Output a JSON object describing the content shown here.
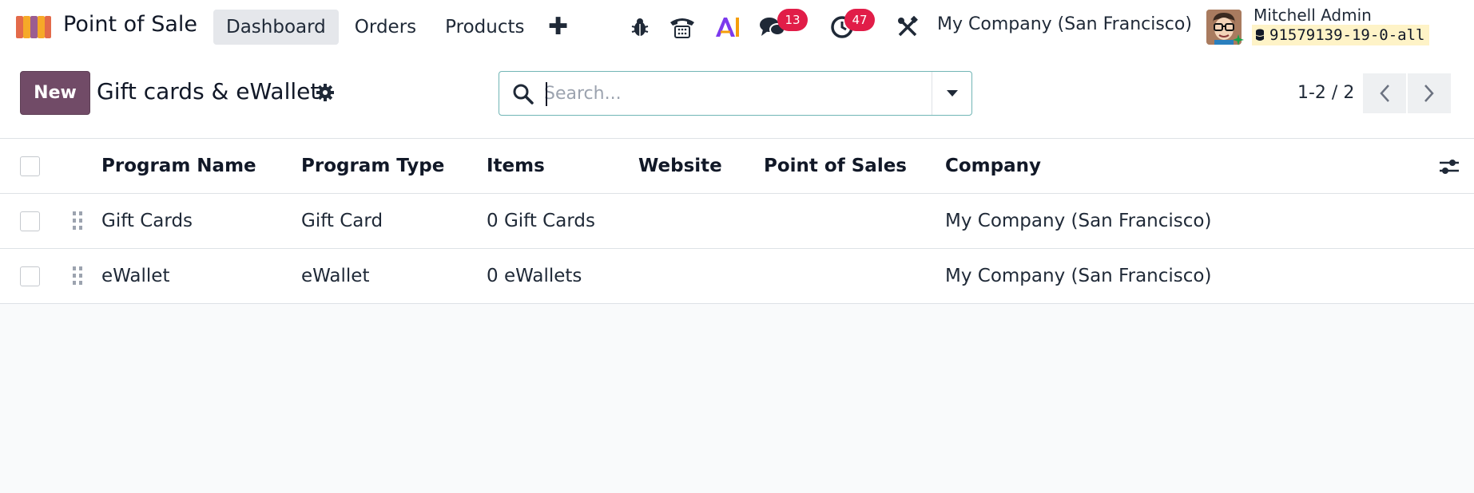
{
  "navbar": {
    "app_name": "Point of Sale",
    "menu": [
      "Dashboard",
      "Orders",
      "Products"
    ],
    "active_menu": "Dashboard",
    "messages_count": "13",
    "activities_count": "47",
    "company": "My Company (San Francisco)",
    "user_name": "Mitchell Admin",
    "database": "91579139-19-0-all"
  },
  "control_panel": {
    "new_label": "New",
    "title": "Gift cards & eWallet",
    "search_placeholder": "Search...",
    "pager": "1-2 / 2"
  },
  "list": {
    "columns": [
      "Program Name",
      "Program Type",
      "Items",
      "Website",
      "Point of Sales",
      "Company"
    ],
    "rows": [
      {
        "program_name": "Gift Cards",
        "program_type": "Gift Card",
        "items": "0 Gift Cards",
        "website": "",
        "pos": "",
        "company": "My Company (San Francisco)"
      },
      {
        "program_name": "eWallet",
        "program_type": "eWallet",
        "items": "0 eWallets",
        "website": "",
        "pos": "",
        "company": "My Company (San Francisco)"
      }
    ]
  },
  "colors": {
    "primary": "#714b67",
    "badge": "#e11d48",
    "search_border": "#71b5b5"
  }
}
